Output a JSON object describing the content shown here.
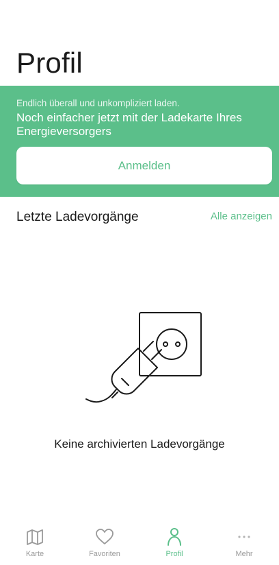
{
  "header": {
    "title": "Profil"
  },
  "banner": {
    "subtitle": "Endlich überall und unkompliziert laden.",
    "headline": "Noch einfacher jetzt mit der Ladekarte Ihres Energieversorgers",
    "button_label": "Anmelden"
  },
  "recent": {
    "title": "Letzte Ladevorgänge",
    "show_all": "Alle anzeigen",
    "empty_message": "Keine archivierten Ladevorgänge",
    "illustration_icon": "plug-socket-icon"
  },
  "tabs": [
    {
      "label": "Karte",
      "icon": "map-icon",
      "active": false
    },
    {
      "label": "Favoriten",
      "icon": "heart-icon",
      "active": false
    },
    {
      "label": "Profil",
      "icon": "person-icon",
      "active": true
    },
    {
      "label": "Mehr",
      "icon": "more-icon",
      "active": false
    }
  ],
  "colors": {
    "accent": "#5bbf8a",
    "inactive": "#9a9a9a",
    "text": "#1a1a1a"
  }
}
